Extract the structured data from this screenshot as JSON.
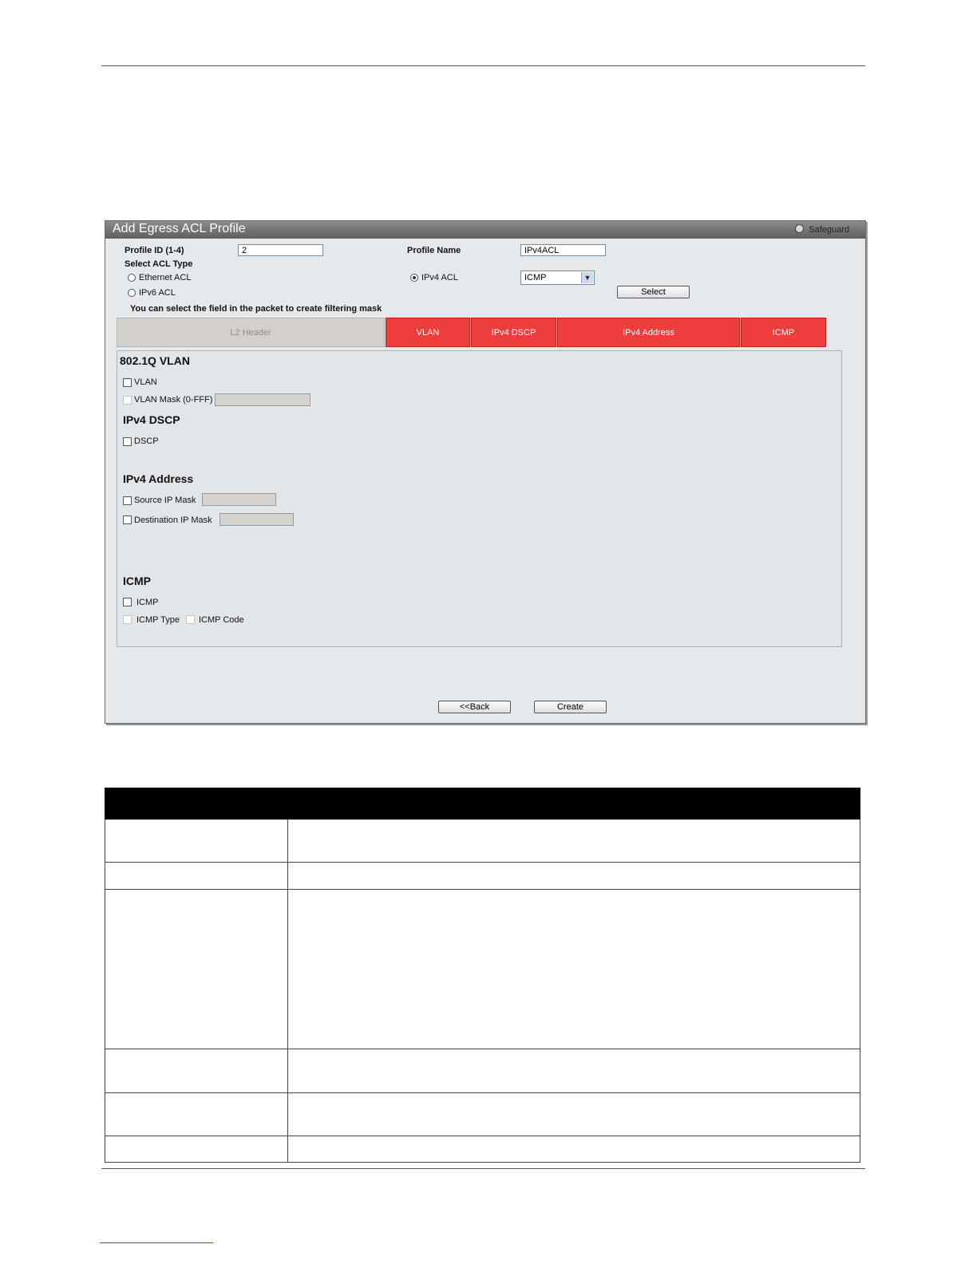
{
  "window": {
    "title": "Add Egress ACL Profile",
    "safeguard_label": "Safeguard"
  },
  "form": {
    "profile_id_label": "Profile ID (1-4)",
    "profile_id_value": "2",
    "profile_name_label": "Profile Name",
    "profile_name_value": "IPv4ACL",
    "select_acl_type_label": "Select ACL Type",
    "ethernet_acl_label": "Ethernet ACL",
    "ipv6_acl_label": "IPv6 ACL",
    "ipv4_acl_label": "IPv4 ACL",
    "ipv4_acl_selected": true,
    "protocol_select_value": "ICMP",
    "select_button": "Select",
    "instruction": "You can select the field in the packet to create filtering mask"
  },
  "tabs": [
    {
      "label": "L2 Header",
      "active": false
    },
    {
      "label": "VLAN",
      "active": true
    },
    {
      "label": "IPv4 DSCP",
      "active": true
    },
    {
      "label": "IPv4 Address",
      "active": true
    },
    {
      "label": "ICMP",
      "active": true
    }
  ],
  "sections": {
    "vlan": {
      "heading": "802.1Q VLAN",
      "vlan_label": "VLAN",
      "vlan_mask_label": "VLAN Mask (0-FFF)"
    },
    "dscp": {
      "heading": "IPv4 DSCP",
      "dscp_label": "DSCP"
    },
    "address": {
      "heading": "IPv4 Address",
      "source_ip_mask_label": "Source IP Mask",
      "destination_ip_mask_label": "Destination IP Mask"
    },
    "icmp": {
      "heading": "ICMP",
      "icmp_label": "ICMP",
      "icmp_type_label": "ICMP Type",
      "icmp_code_label": "ICMP Code"
    }
  },
  "buttons": {
    "back": "<<Back",
    "create": "Create"
  },
  "colors": {
    "active_tab": "#ee3d3d",
    "inactive_tab": "#d3d0cc",
    "title_bar": "#6e6e6e",
    "table_header": "#000000"
  }
}
